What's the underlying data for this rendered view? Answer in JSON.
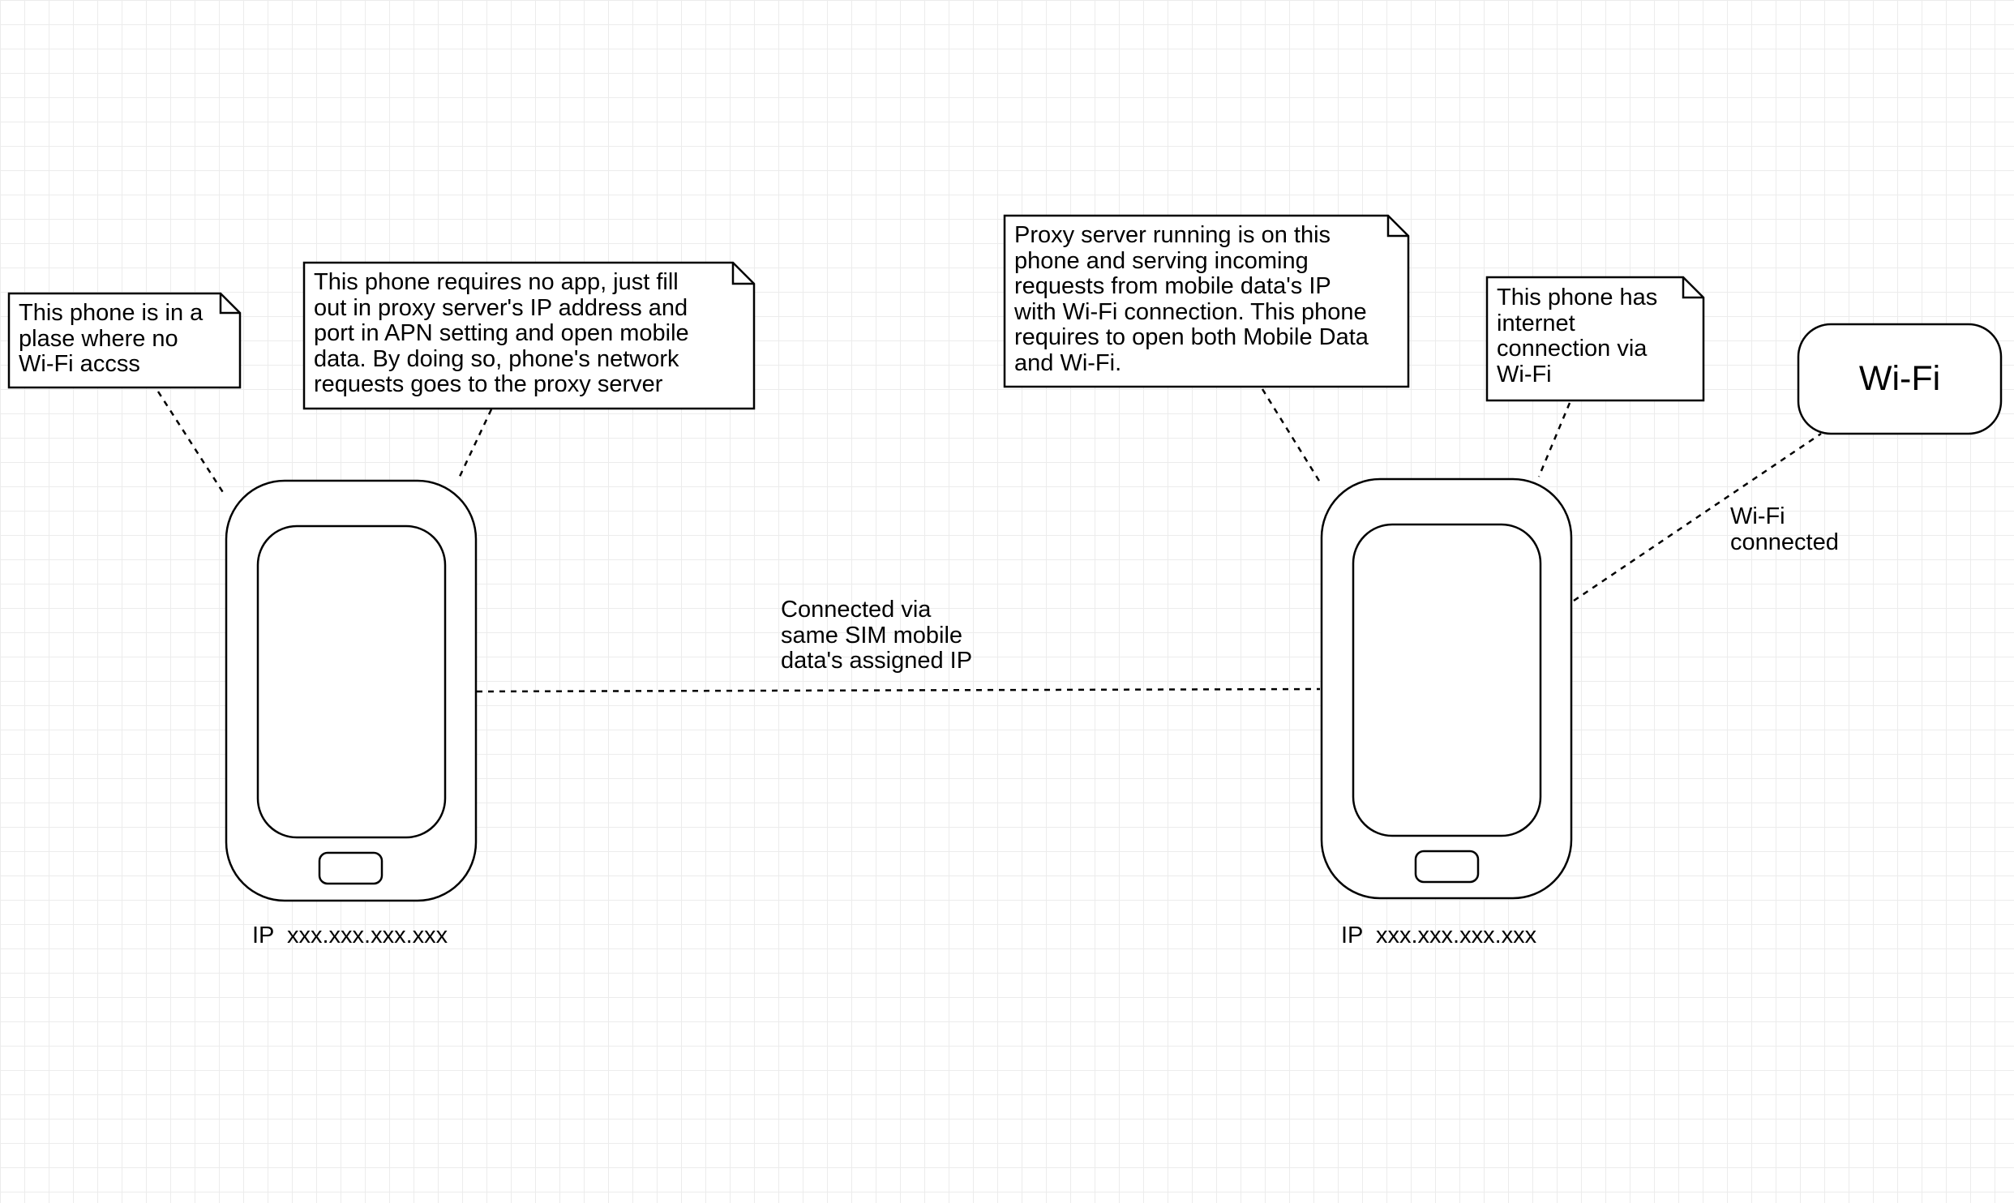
{
  "notes": {
    "left_phone_location": "This phone is in a\nplase where no\nWi-Fi accss",
    "left_phone_setup": "This phone requires no app, just fill\nout in proxy server's IP address and\nport in APN setting and open mobile\ndata. By doing so, phone's network\nrequests goes to the proxy server",
    "proxy_server": "Proxy server running is on this\nphone and serving incoming\nrequests from mobile data's IP\nwith Wi-Fi connection. This phone\nrequires to open both Mobile Data\nand Wi-Fi.",
    "right_phone_internet": "This phone has\ninternet\nconnection via\nWi-Fi"
  },
  "connections": {
    "phones_link": "Connected via\nsame SIM mobile\ndata's assigned IP",
    "wifi_link": "Wi-Fi\nconnected"
  },
  "devices": {
    "left_phone_ip": "IP  xxx.xxx.xxx.xxx",
    "right_phone_ip": "IP  xxx.xxx.xxx.xxx",
    "wifi_node": "Wi-Fi"
  }
}
